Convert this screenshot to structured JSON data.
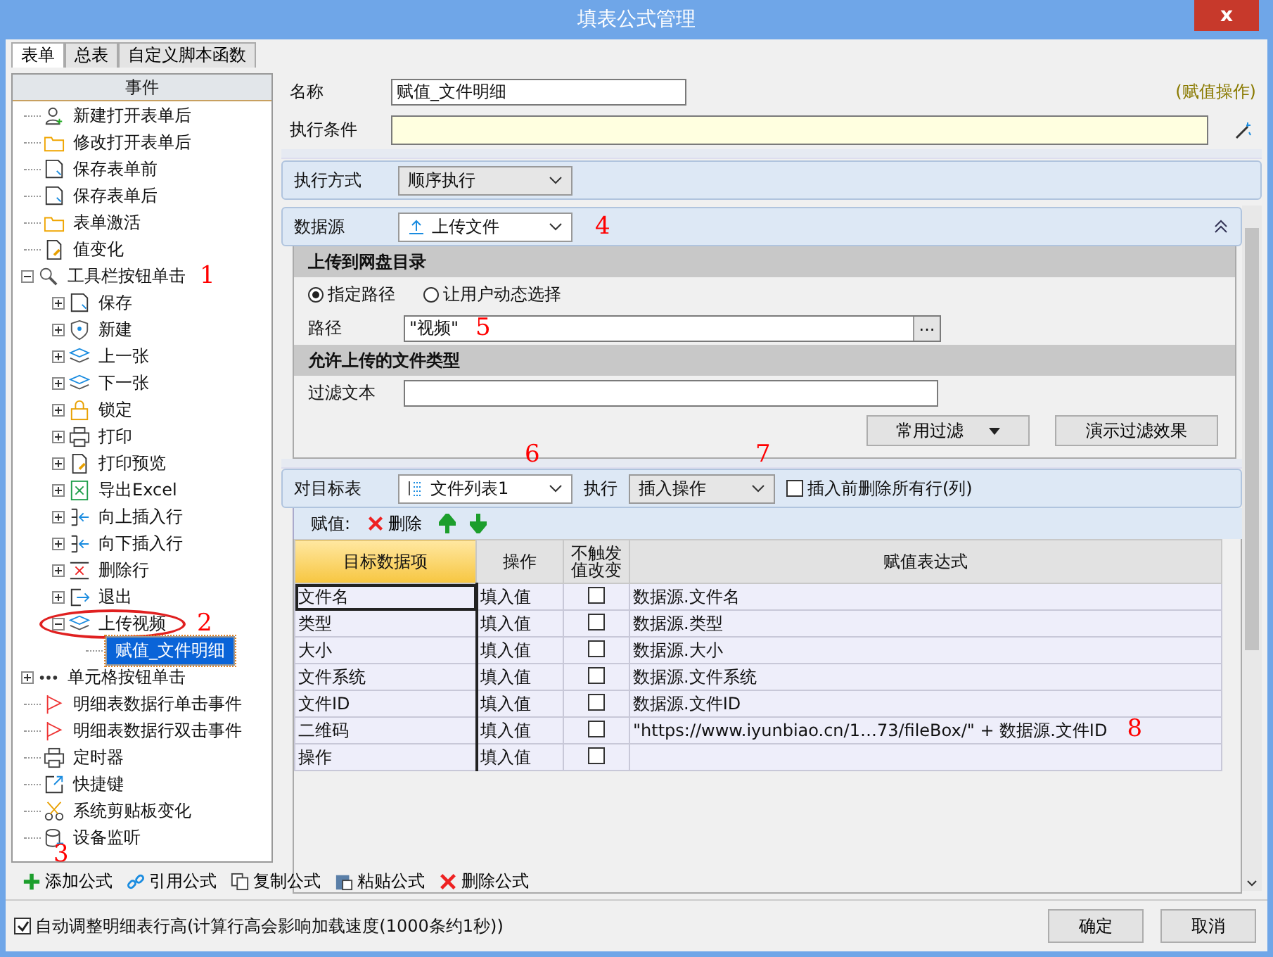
{
  "window": {
    "title": "填表公式管理",
    "close": "x"
  },
  "tabs": [
    {
      "label": "表单",
      "selected": true
    },
    {
      "label": "总表",
      "selected": false
    },
    {
      "label": "自定义脚本函数",
      "selected": false
    }
  ],
  "events": {
    "header": "事件",
    "tree": [
      {
        "label": "新建打开表单后"
      },
      {
        "label": "修改打开表单后"
      },
      {
        "label": "保存表单前"
      },
      {
        "label": "保存表单后"
      },
      {
        "label": "表单激活"
      },
      {
        "label": "值变化"
      },
      {
        "label": "工具栏按钮单击",
        "expanded": true,
        "annotation": "1",
        "children": [
          {
            "label": "保存",
            "expanded": false
          },
          {
            "label": "新建",
            "expanded": false
          },
          {
            "label": "上一张",
            "expanded": false
          },
          {
            "label": "下一张",
            "expanded": false
          },
          {
            "label": "锁定",
            "expanded": false
          },
          {
            "label": "打印",
            "expanded": false
          },
          {
            "label": "打印预览",
            "expanded": false
          },
          {
            "label": "导出Excel",
            "expanded": false
          },
          {
            "label": "向上插入行",
            "expanded": false
          },
          {
            "label": "向下插入行",
            "expanded": false
          },
          {
            "label": "删除行",
            "expanded": false
          },
          {
            "label": "退出",
            "expanded": false
          },
          {
            "label": "上传视频",
            "expanded": true,
            "annotation": "2",
            "circled": true,
            "children": [
              {
                "label": "赋值_文件明细",
                "selected": true
              }
            ]
          }
        ]
      },
      {
        "label": "单元格按钮单击",
        "expanded": false
      },
      {
        "label": "明细表数据行单击事件"
      },
      {
        "label": "明细表数据行双击事件"
      },
      {
        "label": "定时器"
      },
      {
        "label": "快捷键"
      },
      {
        "label": "系统剪贴板变化"
      },
      {
        "label": "设备监听"
      }
    ]
  },
  "formula_toolbar": {
    "annotation": "3",
    "buttons": [
      {
        "label": "添加公式"
      },
      {
        "label": "引用公式"
      },
      {
        "label": "复制公式"
      },
      {
        "label": "粘贴公式"
      },
      {
        "label": "删除公式"
      }
    ]
  },
  "name": {
    "label": "名称",
    "value": "赋值_文件明细",
    "type_note": "(赋值操作)"
  },
  "condition": {
    "label": "执行条件"
  },
  "exec_mode": {
    "label": "执行方式",
    "value": "顺序执行"
  },
  "datasource": {
    "label": "数据源",
    "value": "上传文件",
    "annotation": "4",
    "upload_dir": {
      "title": "上传到网盘目录",
      "options": [
        {
          "label": "指定路径",
          "selected": true
        },
        {
          "label": "让用户动态选择",
          "selected": false
        }
      ],
      "path_label": "路径",
      "path_value": "\"视频\"",
      "path_annotation": "5",
      "browse": "..."
    },
    "file_types": {
      "title": "允许上传的文件类型",
      "filter_label": "过滤文本",
      "common_filter": "常用过滤",
      "demo": "演示过滤效果"
    }
  },
  "target": {
    "label": "对目标表",
    "value": "文件列表1",
    "annotation": "6",
    "exec_label": "执行",
    "exec_value": "插入操作",
    "exec_annotation": "7",
    "clear_before": {
      "label": "插入前删除所有行(列)",
      "checked": false
    }
  },
  "assign_toolbar": {
    "label": "赋值:",
    "delete": "删除"
  },
  "grid": {
    "columns": [
      {
        "label": "目标数据项",
        "selected": true
      },
      {
        "label": "操作",
        "selected": false
      },
      {
        "label": "不触发值改变",
        "selected": false
      },
      {
        "label": "赋值表达式",
        "selected": false
      }
    ],
    "rows": [
      {
        "target": "文件名",
        "op": "填入值",
        "no_trigger": false,
        "expr": "数据源.文件名"
      },
      {
        "target": "类型",
        "op": "填入值",
        "no_trigger": false,
        "expr": "数据源.类型"
      },
      {
        "target": "大小",
        "op": "填入值",
        "no_trigger": false,
        "expr": "数据源.大小"
      },
      {
        "target": "文件系统",
        "op": "填入值",
        "no_trigger": false,
        "expr": "数据源.文件系统"
      },
      {
        "target": "文件ID",
        "op": "填入值",
        "no_trigger": false,
        "expr": "数据源.文件ID"
      },
      {
        "target": "二维码",
        "op": "填入值",
        "no_trigger": false,
        "expr": "\"https://www.iyunbiao.cn/1…73/fileBox/\"  + 数据源.文件ID",
        "annotation": "8"
      },
      {
        "target": "操作",
        "op": "填入值",
        "no_trigger": false
      }
    ]
  },
  "auto_height": {
    "label": "自动调整明细表行高(计算行高会影响加载速度(1000条约1秒))",
    "checked": true
  },
  "buttons": [
    {
      "label": "确定"
    },
    {
      "label": "取消"
    }
  ]
}
